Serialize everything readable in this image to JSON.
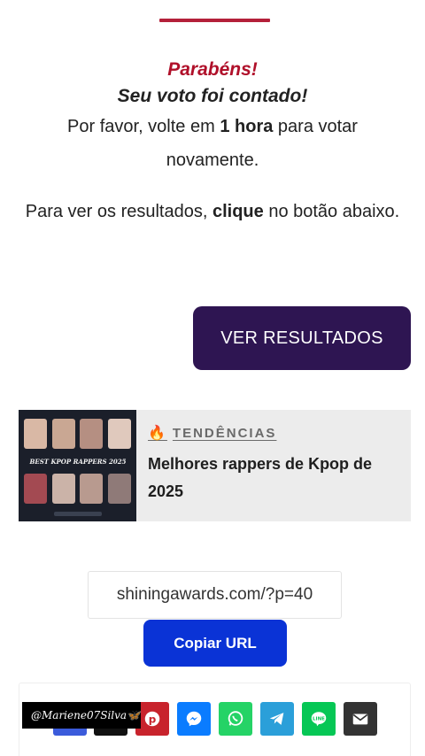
{
  "message": {
    "congrats": "Parabéns!",
    "counted": "Seu voto foi contado!",
    "return_pre": "Por favor, volte em ",
    "return_bold": "1 hora",
    "return_post": " para votar novamente.",
    "results_pre": "Para ver os resultados, ",
    "results_bold": "clique",
    "results_post": " no botão abaixo."
  },
  "results_button": {
    "label": "VER RESULTADOS"
  },
  "trending": {
    "tag": "TENDÊNCIAS",
    "title": "Melhores rappers de Kpop de 2025",
    "thumb_banner": "BEST KPOP RAPPERS 2025"
  },
  "share": {
    "url": "shiningawards.com/?p=40",
    "copy_label": "Copiar URL",
    "buttons": [
      {
        "name": "pinterest",
        "color": "#c8232c"
      },
      {
        "name": "messenger",
        "color": "#0a7cff"
      },
      {
        "name": "whatsapp",
        "color": "#25d366"
      },
      {
        "name": "telegram",
        "color": "#2b9fd9"
      },
      {
        "name": "line",
        "color": "#06c755"
      },
      {
        "name": "email",
        "color": "#333333"
      }
    ]
  },
  "watermark": {
    "text": "@Mariene07Silva🦋"
  },
  "colors": {
    "accent": "#b0102a",
    "primary_button": "#2e1552",
    "copy_button": "#0a33d6"
  }
}
